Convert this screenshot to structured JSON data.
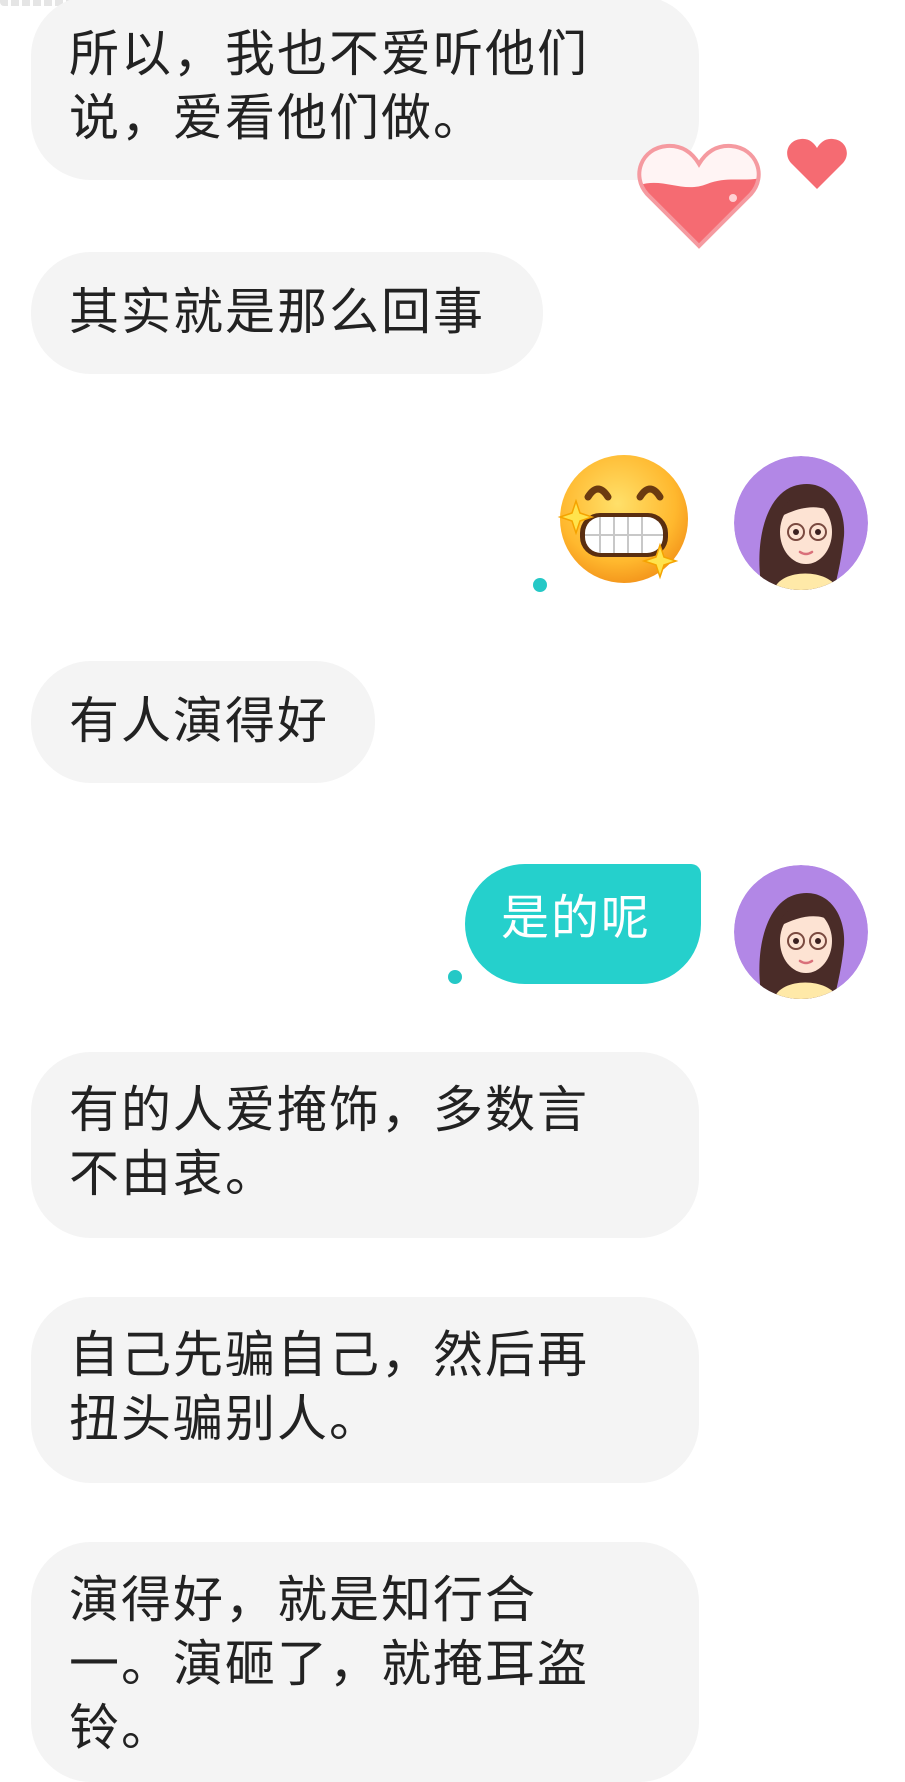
{
  "chat": {
    "messages_in": [
      {
        "lines": [
          "所以，我也不爱听他们",
          "说，爱看他们做。"
        ]
      },
      {
        "lines": [
          "其实就是那么回事"
        ]
      },
      {
        "lines": [
          "有人演得好"
        ]
      },
      {
        "lines": [
          "有的人爱掩饰，多数言",
          "不由衷。"
        ]
      },
      {
        "lines": [
          "自己先骗自己，然后再",
          "扭头骗别人。"
        ]
      },
      {
        "lines": [
          "演得好，就是知行合",
          "一。演砸了，就掩耳盗",
          "铃。"
        ]
      }
    ],
    "messages_out": [
      {
        "type": "emoji",
        "emoji": "grinning-face-with-sparkles"
      },
      {
        "type": "text",
        "text": "是的呢"
      }
    ]
  },
  "colors": {
    "incoming_bubble": "#f4f4f4",
    "outgoing_bubble": "#25d0cc",
    "read_dot": "#25c8c6",
    "heart": "#f56b72",
    "avatar_bg": "#b287e6"
  },
  "icons": {
    "reaction_big": "heart-icon",
    "reaction_small": "heart-icon",
    "avatar": "avatar-woman-glasses"
  }
}
